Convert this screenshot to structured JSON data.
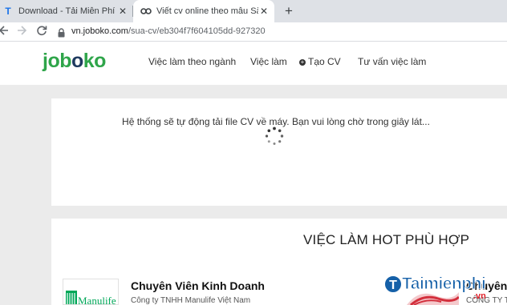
{
  "browser": {
    "tabs": [
      {
        "title": "Download - Tải Miễn Phí VN - Ph",
        "favicon": "T",
        "active": false
      },
      {
        "title": "Viết cv online theo mẫu Sắc màu",
        "favicon": "link-icon",
        "active": true
      }
    ],
    "close_glyph": "✕",
    "new_tab_glyph": "+",
    "url_domain": "vn.joboko.com",
    "url_path": "/sua-cv/eb304f7f604105dd-927320"
  },
  "site": {
    "logo_part1": "job",
    "logo_part2": "o",
    "logo_part3": "ko",
    "nav": [
      "Việc làm theo ngành",
      "Việc làm",
      "Tạo CV",
      "Tư vấn việc làm"
    ]
  },
  "loading": {
    "message": "Hệ thống sẽ tự động tải file CV về máy. Bạn vui lòng chờ trong giây lát..."
  },
  "hot_jobs": {
    "title": "VIỆC LÀM HOT PHÙ HỢP",
    "jobs": [
      {
        "title": "Chuyên Viên Kinh Doanh",
        "company": "Công ty TNHH Manulife Việt Nam",
        "logo_text": "Manulife"
      },
      {
        "title": "Chuyên",
        "company": "CÔNG TY T"
      }
    ]
  },
  "watermark": {
    "text": "Taimienphi",
    "suffix": ".vn",
    "badge": "T"
  },
  "colors": {
    "brand_green": "#2fa54a",
    "brand_navy": "#1f3a5f",
    "manulife_green": "#00a758"
  }
}
